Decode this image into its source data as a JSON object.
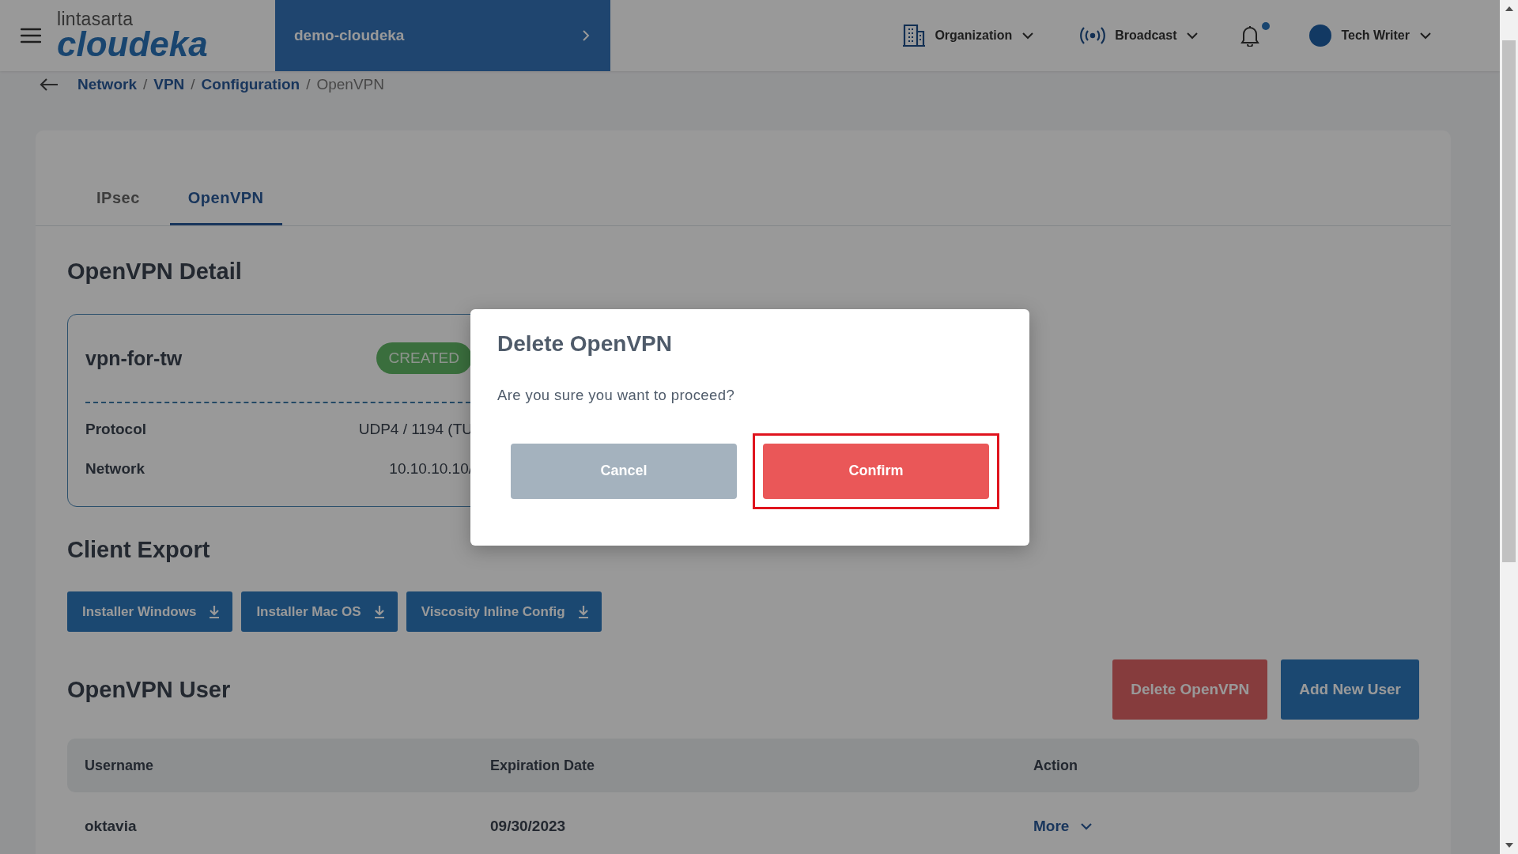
{
  "header": {
    "logo": {
      "brand": "lintasarta",
      "product": "cloudeka"
    },
    "project": "demo-cloudeka",
    "organization_menu": {
      "label": "Organization"
    },
    "broadcast_menu": {
      "label": "Broadcast"
    },
    "notifications": {
      "unread": true
    },
    "user": {
      "name": "Tech Writer"
    }
  },
  "breadcrumb": [
    {
      "label": "Network",
      "link": true
    },
    {
      "separator": "/",
      "label": "VPN",
      "link": true
    },
    {
      "separator": "/",
      "label": "Configuration",
      "link": true
    },
    {
      "separator": "/",
      "label": "OpenVPN",
      "link": false
    }
  ],
  "tabs": [
    {
      "label": "IPsec",
      "selected": false
    },
    {
      "label": "OpenVPN",
      "selected": true
    }
  ],
  "detail": {
    "title": "OpenVPN Detail",
    "name": "vpn-for-tw",
    "status": "CREATED",
    "fields": [
      {
        "label": "Protocol",
        "value": "UDP4 / 1194 (TU"
      },
      {
        "label": "Network",
        "value": "10.10.10.10/"
      }
    ]
  },
  "client_export": {
    "title": "Client Export",
    "buttons": [
      "Installer Windows",
      "Installer Mac OS",
      "Viscosity Inline Config"
    ]
  },
  "users": {
    "title": "OpenVPN User",
    "actions": [
      {
        "label": "Delete OpenVPN",
        "kind": "danger"
      },
      {
        "label": "Add New User",
        "kind": "primary"
      }
    ],
    "columns": [
      "Username",
      "Expiration Date",
      "Action"
    ],
    "rows": [
      {
        "username": "oktavia",
        "expiration": "09/30/2023",
        "action": "More"
      }
    ]
  },
  "dialog": {
    "title": "Delete OpenVPN",
    "message": "Are you sure you want to proceed?",
    "buttons": [
      {
        "label": "Cancel",
        "kind": "secondary",
        "highlighted": false
      },
      {
        "label": "Confirm",
        "kind": "danger",
        "highlighted": true
      }
    ]
  }
}
